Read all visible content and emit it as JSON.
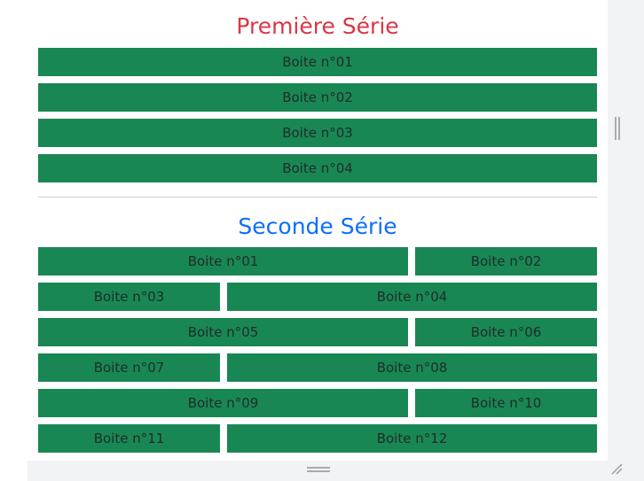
{
  "section1": {
    "title": "Première Série",
    "boxes": [
      "Boite n°01",
      "Boite n°02",
      "Boite n°03",
      "Boite n°04"
    ]
  },
  "section2": {
    "title": "Seconde Série",
    "boxes": [
      "Boite n°01",
      "Boite n°02",
      "Boite n°03",
      "Boite n°04",
      "Boite n°05",
      "Boite n°06",
      "Boite n°07",
      "Boite n°08",
      "Boite n°09",
      "Boite n°10",
      "Boite n°11",
      "Boite n°12"
    ]
  },
  "colors": {
    "box_background": "#198754",
    "first_title": "#dc3545",
    "second_title": "#0d6efd"
  }
}
